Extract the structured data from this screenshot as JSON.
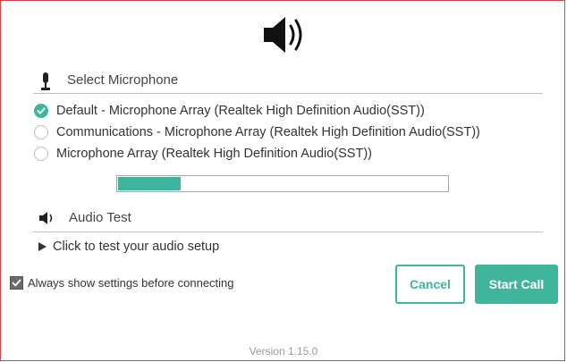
{
  "header": {
    "icon": "speaker-icon"
  },
  "microphone": {
    "title": "Select Microphone",
    "icon": "microphone-icon",
    "options": [
      {
        "label": "Default - Microphone Array (Realtek High Definition Audio(SST))",
        "selected": true
      },
      {
        "label": "Communications - Microphone Array (Realtek High Definition Audio(SST))",
        "selected": false
      },
      {
        "label": "Microphone Array (Realtek High Definition Audio(SST))",
        "selected": false
      }
    ],
    "input_level": 0.19
  },
  "audio_test": {
    "title": "Audio Test",
    "icon": "speaker-small-icon",
    "link": "Click to test your audio setup"
  },
  "footer": {
    "always_show_label": "Always show settings before connecting",
    "always_show_checked": true,
    "cancel_label": "Cancel",
    "start_label": "Start Call",
    "version": "Version 1.15.0"
  },
  "colors": {
    "accent": "#3fb59c",
    "border": "#c94a4a"
  }
}
